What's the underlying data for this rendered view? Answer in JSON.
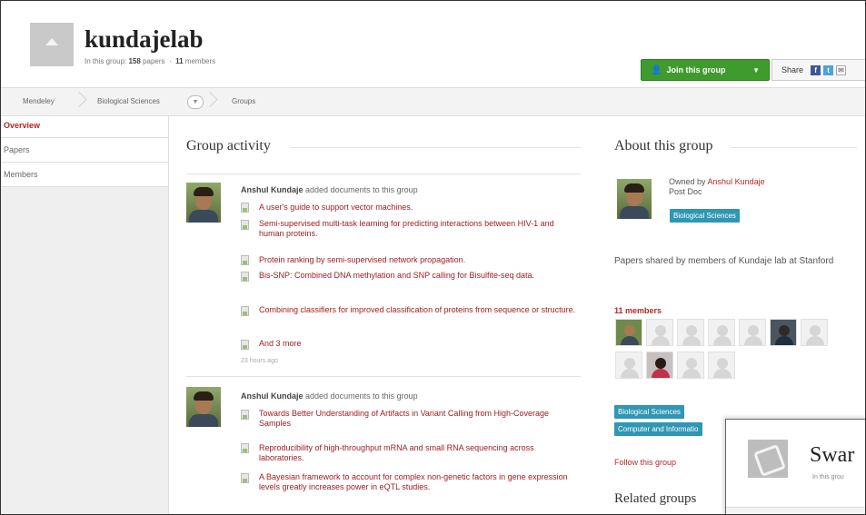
{
  "group": {
    "name": "kundajelab",
    "meta_prefix": "In this group:",
    "papers_count": "158",
    "papers_label": "papers",
    "members_count": "11",
    "members_label": "members"
  },
  "actions": {
    "join_label": "Join this group",
    "share_label": "Share"
  },
  "breadcrumb": [
    "Mendeley",
    "Biological Sciences",
    "Groups"
  ],
  "sidebar": {
    "items": [
      {
        "label": "Overview",
        "active": true
      },
      {
        "label": "Papers"
      },
      {
        "label": "Members"
      }
    ]
  },
  "activity": {
    "title": "Group activity",
    "entries": [
      {
        "user": "Anshul Kundaje",
        "action": "added documents to this group",
        "docs": [
          "A user's guide to support vector machines.",
          "Semi-supervised multi-task learning for predicting interactions between HIV-1 and human proteins.",
          "Protein ranking by semi-supervised network propagation.",
          "Bis-SNP: Combined DNA methylation and SNP calling for Bisulfite-seq data.",
          "Combining classifiers for improved classification of proteins from sequence or structure.",
          "And 3 more"
        ],
        "time": "23 hours ago"
      },
      {
        "user": "Anshul Kundaje",
        "action": "added documents to this group",
        "docs": [
          "Towards Better Understanding of Artifacts in Variant Calling from High-Coverage Samples",
          "Reproducibility of high-throughput mRNA and small RNA sequencing across laboratories.",
          "A Bayesian framework to account for complex non-genetic factors in gene expression levels greatly increases power in eQTL studies."
        ]
      }
    ]
  },
  "about": {
    "title": "About this group",
    "owned_prefix": "Owned by",
    "owner": "Anshul Kundaje",
    "owner_role": "Post Doc",
    "owner_tag": "Biological Sciences",
    "description": "Papers shared by members of Kundaje lab at Stanford",
    "members_label": "11 members",
    "tags": [
      "Biological Sciences",
      "Computer and Informatio"
    ],
    "follow_label": "Follow this group",
    "related_title": "Related groups"
  },
  "popup": {
    "name": "Swar",
    "meta": "In this grou"
  },
  "colors": {
    "join_green": "#3f9b2d",
    "link_red": "#a02020",
    "tag_blue": "#2f96b4"
  }
}
